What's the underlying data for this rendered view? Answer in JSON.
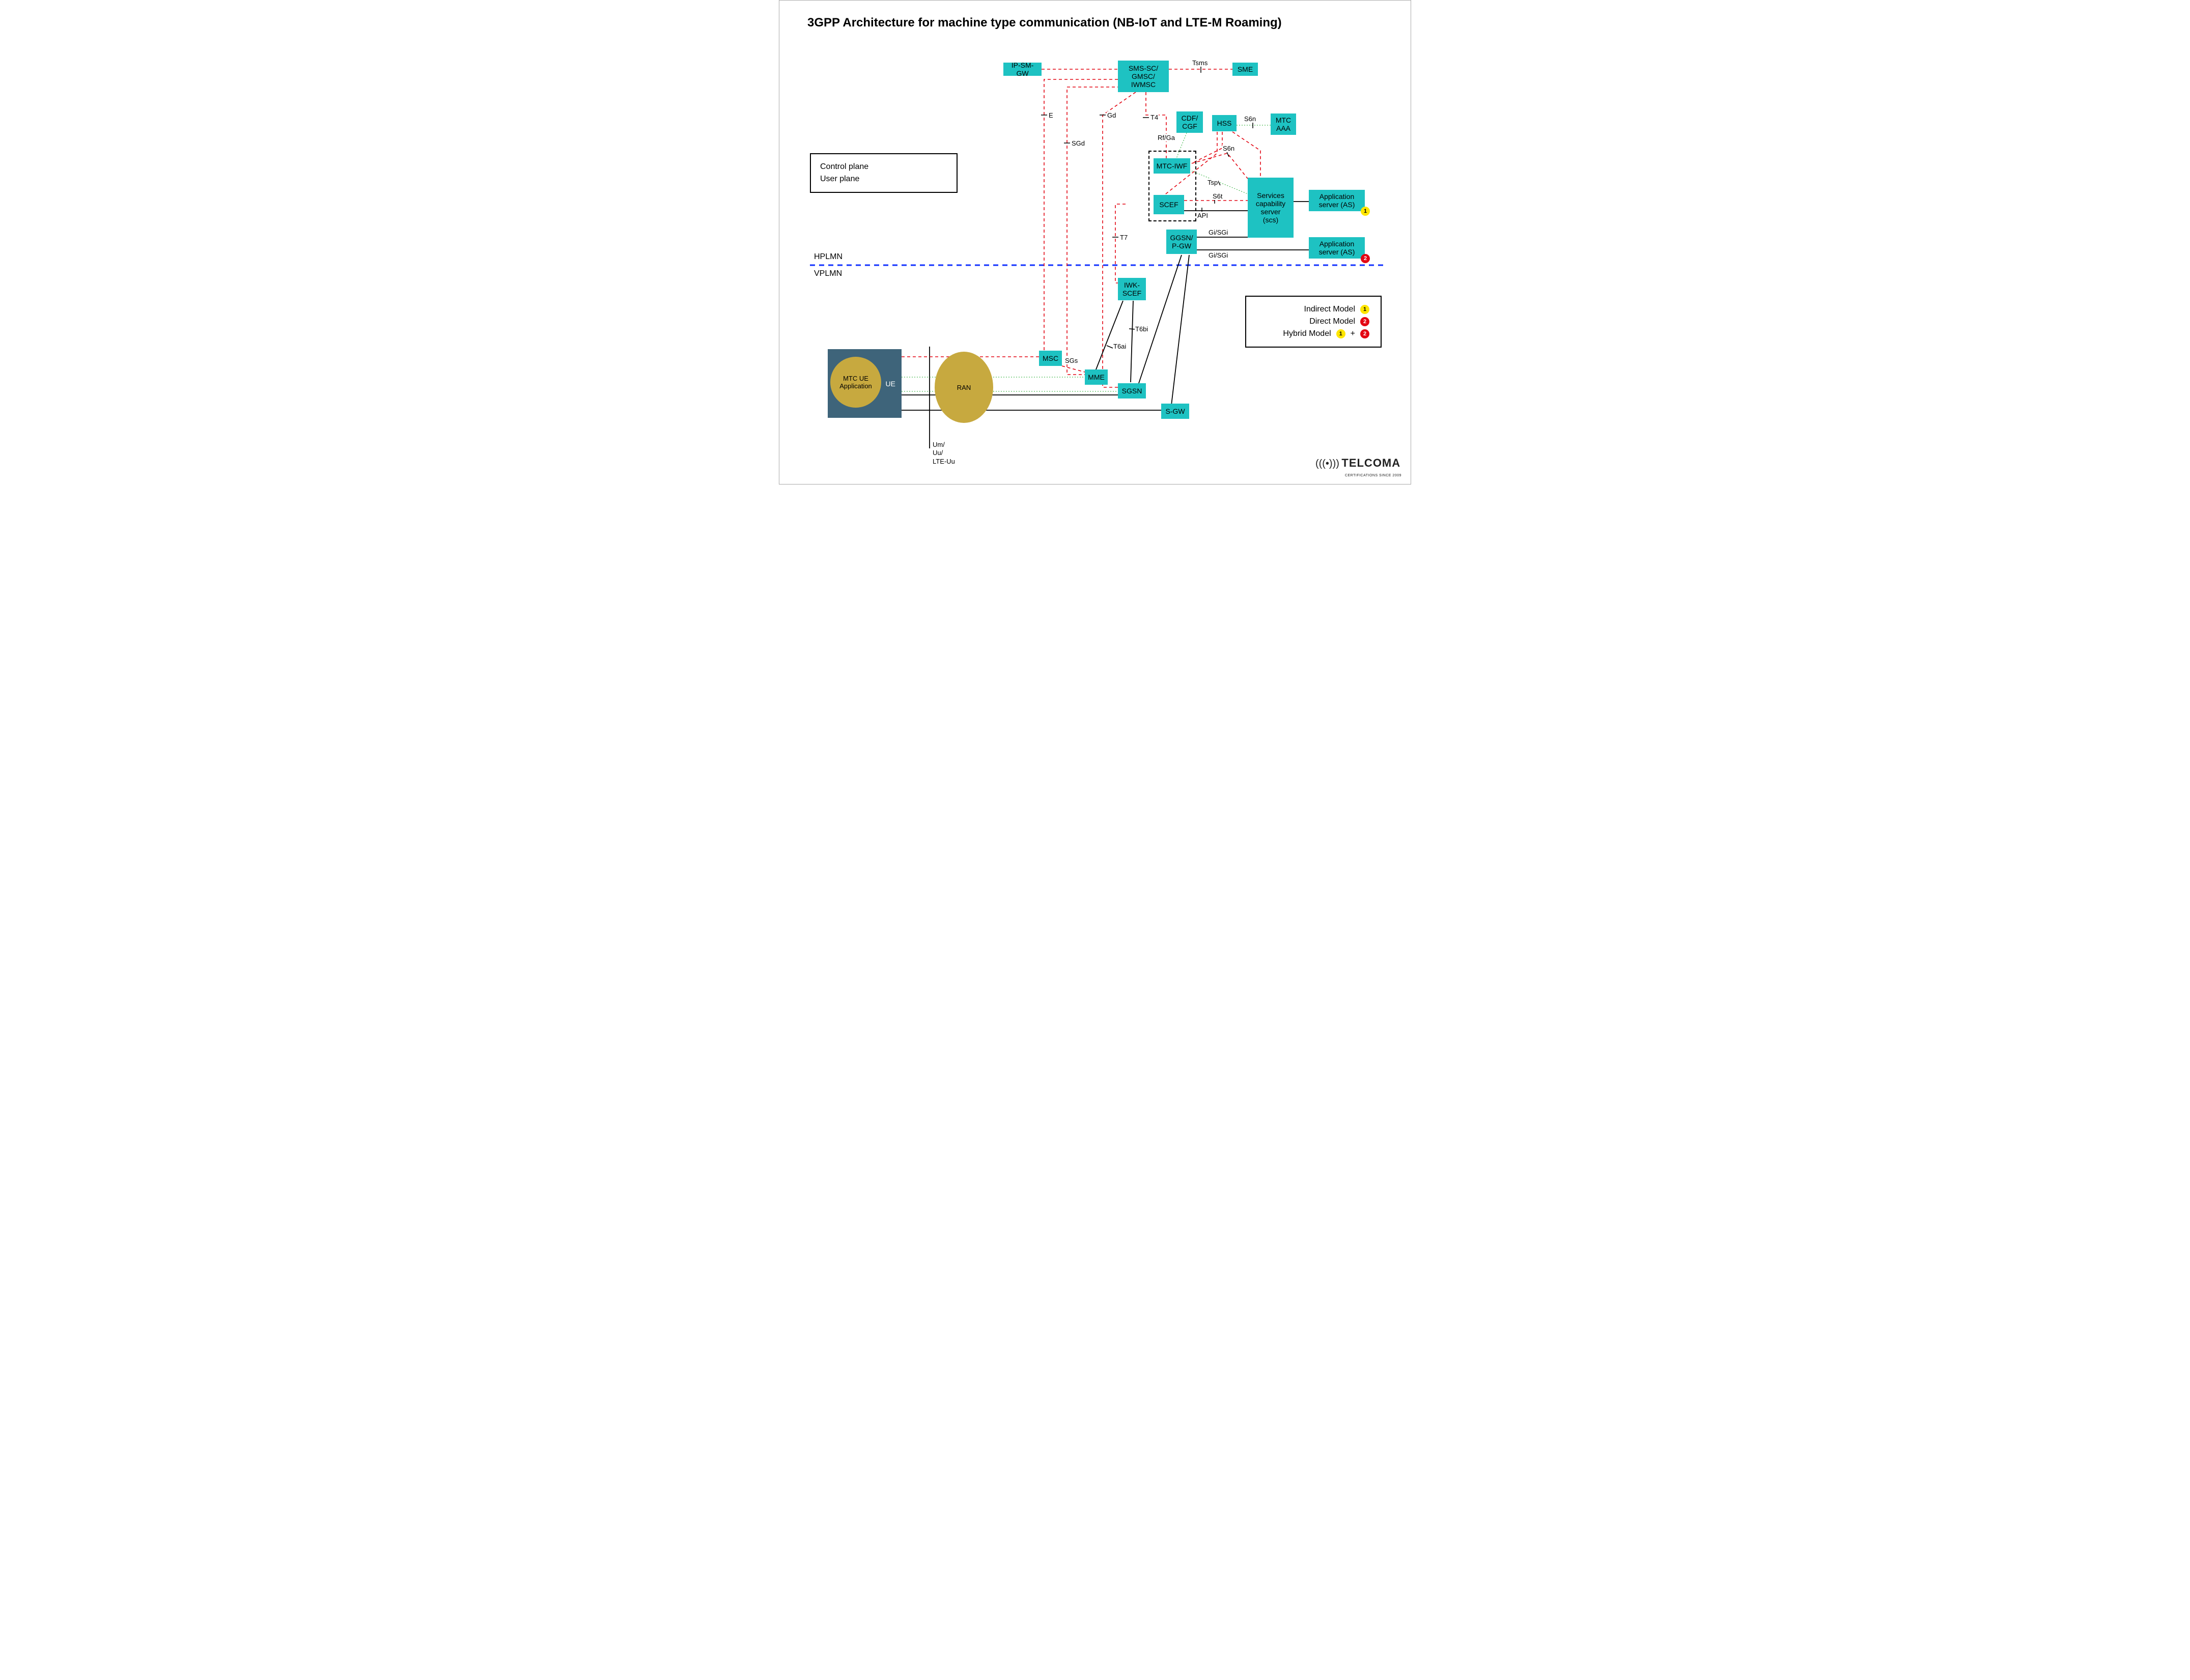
{
  "title": "3GPP Architecture for machine type communication (NB-IoT and LTE-M Roaming)",
  "regions": {
    "hplmn": "HPLMN",
    "vplmn": "VPLMN"
  },
  "legend": {
    "control_plane": "Control plane",
    "user_plane": "User plane"
  },
  "models": {
    "indirect": "Indirect Model",
    "direct": "Direct Model",
    "hybrid": "Hybrid Model"
  },
  "nodes": {
    "ipsmgw": "IP-SM-GW",
    "smssc": "SMS-SC/\nGMSC/\nIWMSC",
    "sme": "SME",
    "cdf": "CDF/\nCGF",
    "hss": "HSS",
    "mtcaaa": "MTC\nAAA",
    "mtciwf": "MTC-IWF",
    "scef": "SCEF",
    "scs": "Services\ncapability\nserver\n(scs)",
    "as1": "Application\nserver (AS)",
    "as2": "Application\nserver (AS)",
    "ggsn": "GGSN/\nP-GW",
    "iwkscef": "IWK-\nSCEF",
    "msc": "MSC",
    "mme": "MME",
    "sgsn": "SGSN",
    "sgw": "S-GW",
    "ue": "UE",
    "mtcue": "MTC UE\nApplication",
    "ran": "RAN"
  },
  "iface": {
    "tsms": "Tsms",
    "e": "E",
    "gd": "Gd",
    "sgd": "SGd",
    "t4": "T4",
    "rfga": "Rf/Ga",
    "s6n1": "S6n",
    "s6n2": "S6n",
    "tsp": "Tsp",
    "s6t": "S6t",
    "api": "API",
    "gisgi1": "Gi/SGi",
    "gisgi2": "Gi/SGi",
    "t7": "T7",
    "t6bi": "T6bi",
    "t6ai": "T6ai",
    "sgs": "SGs",
    "um": "Um/\nUu/\nLTE-Uu"
  },
  "logo": {
    "name": "TELCOMA",
    "tag": "CERTIFICATIONS SINCE 2009"
  }
}
